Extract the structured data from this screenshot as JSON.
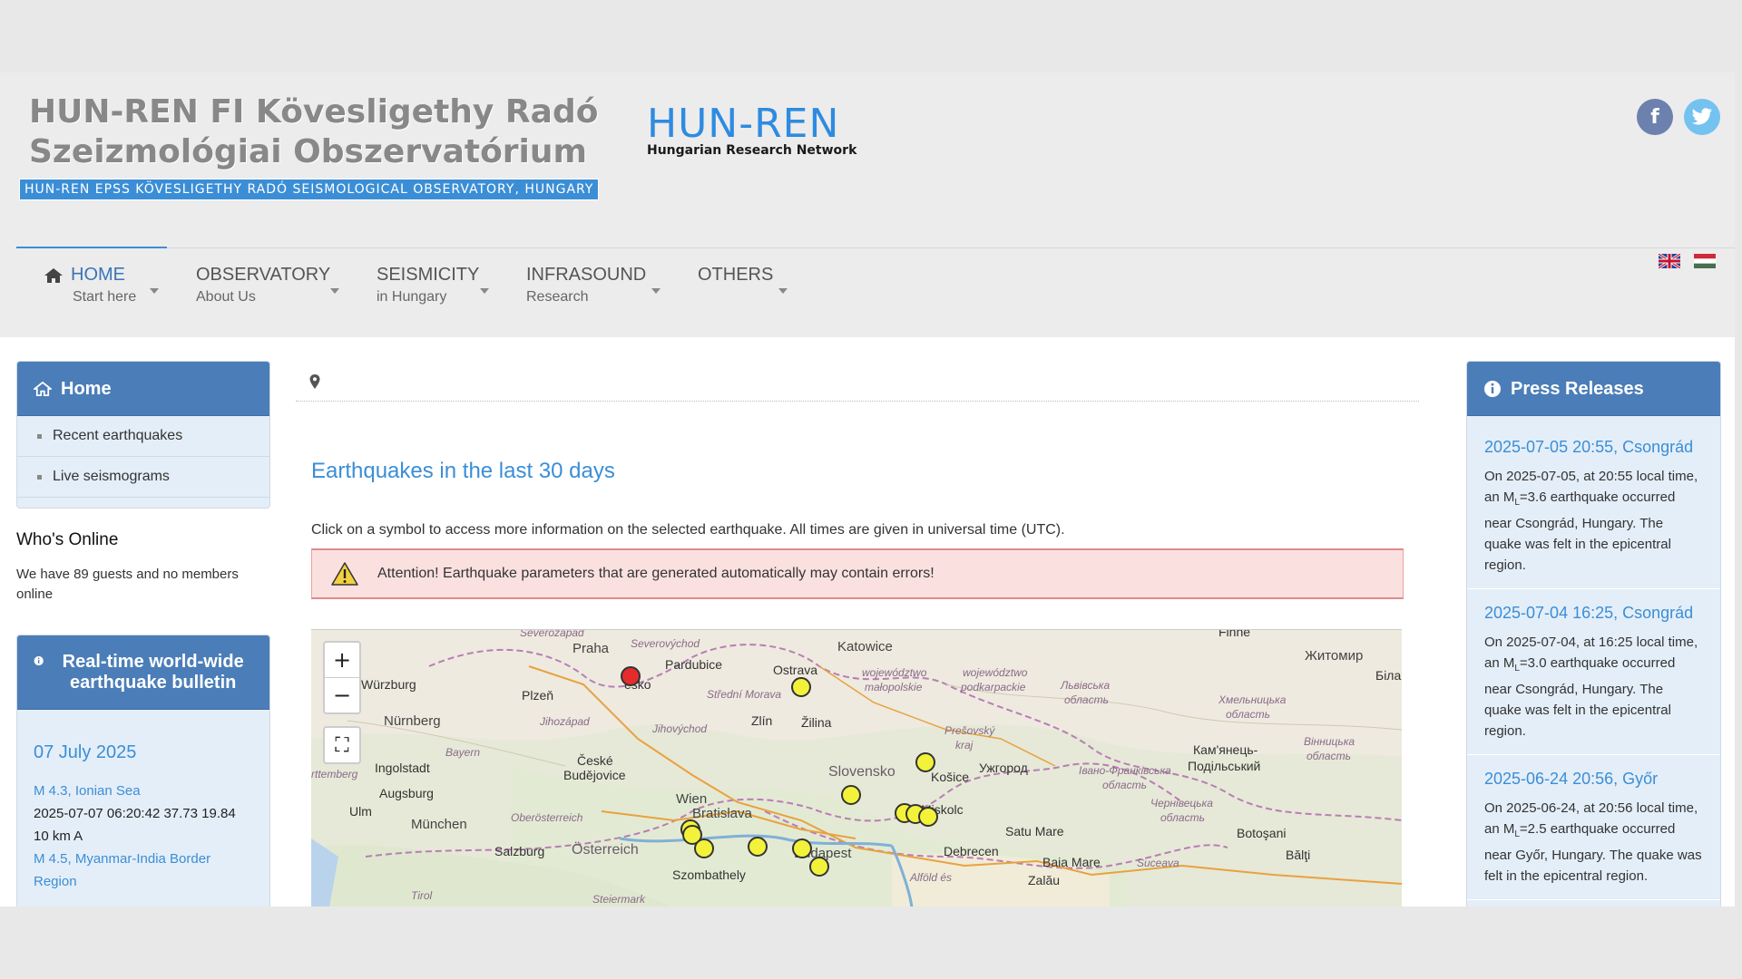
{
  "header": {
    "title_line1": "HUN-REN FI Kövesligethy Radó",
    "title_line2": "Szeizmológiai Obszervatórium",
    "subtitle": "HUN-REN EPSS KÖVESLIGETHY RADÓ SEISMOLOGICAL OBSERVATORY, HUNGARY",
    "logo_big": "HUN-REN",
    "logo_small": "Hungarian Research Network",
    "social": {
      "facebook_label": "f",
      "twitter_label": "t"
    }
  },
  "nav": [
    {
      "label": "HOME",
      "sub": "Start here",
      "active": true
    },
    {
      "label": "OBSERVATORY",
      "sub": "About Us"
    },
    {
      "label": "SEISMICITY",
      "sub": "in Hungary"
    },
    {
      "label": "INFRASOUND",
      "sub": "Research"
    },
    {
      "label": "OTHERS",
      "sub": ""
    }
  ],
  "sidebar_left": {
    "home_panel": {
      "title": "Home",
      "items": [
        "Recent earthquakes",
        "Live seismograms"
      ]
    },
    "whos_online": {
      "title": "Who's Online",
      "text": "We have 89 guests and no members online"
    },
    "bulletin": {
      "title": "Real-time world-wide earthquake bulletin",
      "date": "07 July 2025",
      "quake1_link": "M 4.3, Ionian Sea",
      "quake1_line1": "2025-07-07 06:20:42 37.73 19.84",
      "quake1_line2": "10 km A",
      "quake2_link": "M 4.5, Myanmar-India Border Region"
    }
  },
  "main": {
    "heading": "Earthquakes in the last 30 days",
    "lead": "Click on a symbol to access more information on the selected earthquake. All times are given in universal time (UTC).",
    "alert": "Attention! Earthquake parameters that are generated automatically may contain errors!",
    "map": {
      "zoom_in": "+",
      "zoom_out": "−",
      "fullscreen": "⛶",
      "labels": {
        "praha": "Praha",
        "pardubice": "Pardubice",
        "ostrava": "Ostrava",
        "katowice": "Katowice",
        "zhytomyr": "Житомир",
        "bila": "Біла",
        "wurzburg": "Würzburg",
        "plzen": "Plzeň",
        "nurnberg": "Nürnberg",
        "zlin": "Zlín",
        "zilina": "Žilina",
        "ingolstadt": "Ingolstadt",
        "ceske": "České",
        "budejovice": "Budějovice",
        "augsburg": "Augsburg",
        "ulm": "Ulm",
        "munchen": "München",
        "wien": "Wien",
        "bratislava": "Bratislava",
        "slovensko": "Slovensko",
        "kosice": "Košice",
        "uzhhorod": "Ужгород",
        "kamianets": "Кам'янець-",
        "podilskyi": "Подільський",
        "salzburg": "Salzburg",
        "osterreich": "Österreich",
        "szombathely": "Szombathely",
        "budapest": "Budapest",
        "debrecen": "Debrecen",
        "satu_mare": "Satu Mare",
        "baia_mare": "Baia Mare",
        "zalau": "Zalău",
        "botosani": "Botoşani",
        "balti": "Bălţi",
        "miskolc": "Miskolc",
        "presovsky": "Prešovský",
        "kraj": "kraj",
        "severo": "Severovýchod",
        "esko": "esko",
        "stredni": "Střední Morava",
        "jihozapad": "Jihozápad",
        "jihovychod": "Jihovýchod",
        "bayern": "Bayern",
        "oberosterreich": "Oberösterreich",
        "tirol": "Tirol",
        "steiermark": "Steiermark",
        "slaskie": "województwo",
        "malopolskie": "małopolskie",
        "podkarpackie_1": "województwo",
        "podkarpackie_2": "podkarpackie",
        "lviv_1": "Львівська",
        "lviv_2": "область",
        "khmel_1": "Хмельницька",
        "khmel_2": "область",
        "ivano_1": "Івано-Франківська",
        "ivano_2": "область",
        "cherniv_1": "Чернівецька",
        "cherniv_2": "область",
        "vinnyts_1": "Вінницька",
        "vinnyts_2": "область",
        "alfold": "Alföld és",
        "suceava": "Suceava",
        "rttemberg": "rttemberg",
        "fihne": "Fihne",
        "secho": "Severozápad"
      }
    }
  },
  "sidebar_right": {
    "title": "Press Releases",
    "items": [
      {
        "title": "2025-07-05 20:55, Csongrád",
        "text_a": "On 2025-07-05, at 20:55 local time, an M",
        "sub": "L",
        "text_b": "=3.6 earthquake occurred near Csongrád, Hungary. The quake was felt in the epicentral region."
      },
      {
        "title": "2025-07-04 16:25, Csongrád",
        "text_a": "On 2025-07-04, at 16:25 local time, an M",
        "sub": "L",
        "text_b": "=3.0 earthquake occurred near Csongrád, Hungary. The quake was felt in the epicentral region."
      },
      {
        "title": "2025-06-24 20:56, Győr",
        "text_a": "On 2025-06-24, at 20:56 local time, an M",
        "sub": "L",
        "text_b": "=2.5 earthquake occurred near Győr, Hungary. The quake was felt in the epicentral region."
      }
    ]
  },
  "colors": {
    "accent": "#3b8ed6",
    "panel_head": "#4b7eb8",
    "panel_bg": "#e4eef8",
    "quake_auto": "#f3f23a",
    "quake_recent": "#e52b2b"
  }
}
